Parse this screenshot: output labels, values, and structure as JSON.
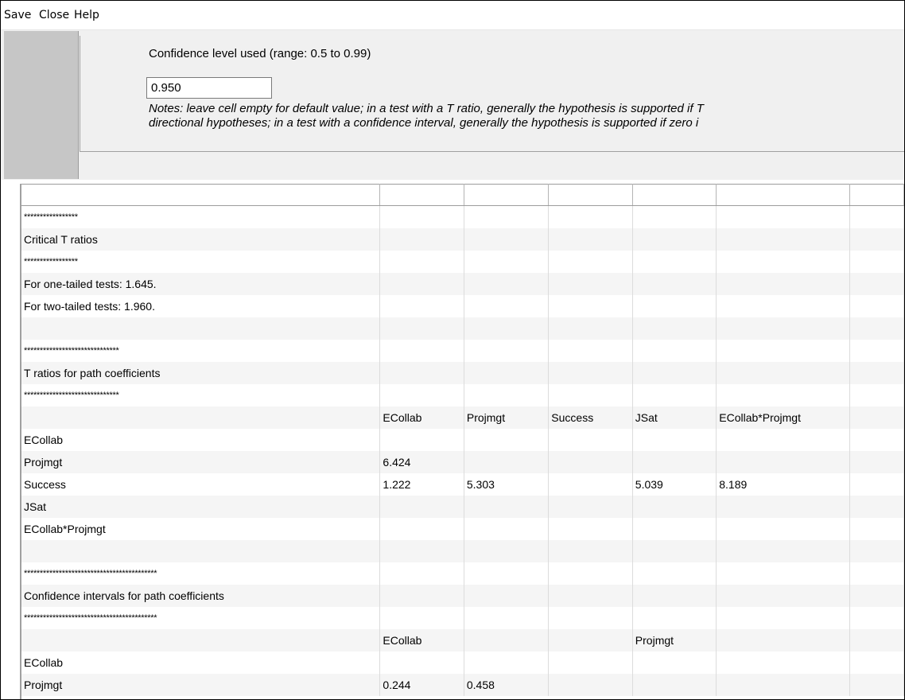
{
  "menu": [
    "Save",
    "Close",
    "Help"
  ],
  "settings": {
    "confidence_label": "Confidence level used (range: 0.5 to 0.99)",
    "confidence_value": "0.950",
    "notes_line1": "Notes: leave cell empty for default value; in a test with a T ratio, generally the hypothesis is supported if T",
    "notes_line2": "directional hypotheses; in a test with a confidence interval, generally the hypothesis is supported if zero i"
  },
  "grid": {
    "columns": [
      "",
      "",
      "",
      "",
      "",
      "",
      ""
    ],
    "rows": [
      [
        "*****************",
        "",
        "",
        "",
        "",
        "",
        ""
      ],
      [
        "Critical T ratios",
        "",
        "",
        "",
        "",
        "",
        ""
      ],
      [
        "*****************",
        "",
        "",
        "",
        "",
        "",
        ""
      ],
      [
        "For one-tailed tests: 1.645.",
        "",
        "",
        "",
        "",
        "",
        ""
      ],
      [
        "For two-tailed tests: 1.960.",
        "",
        "",
        "",
        "",
        "",
        ""
      ],
      [
        "",
        "",
        "",
        "",
        "",
        "",
        ""
      ],
      [
        "******************************",
        "",
        "",
        "",
        "",
        "",
        ""
      ],
      [
        "T ratios for path coefficients",
        "",
        "",
        "",
        "",
        "",
        ""
      ],
      [
        "******************************",
        "",
        "",
        "",
        "",
        "",
        ""
      ],
      [
        "",
        "ECollab",
        "Projmgt",
        "Success",
        "JSat",
        "ECollab*Projmgt",
        ""
      ],
      [
        "ECollab",
        "",
        "",
        "",
        "",
        "",
        ""
      ],
      [
        "Projmgt",
        "6.424",
        "",
        "",
        "",
        "",
        ""
      ],
      [
        "Success",
        "1.222",
        "5.303",
        "",
        "5.039",
        "8.189",
        ""
      ],
      [
        "JSat",
        "",
        "",
        "",
        "",
        "",
        ""
      ],
      [
        "ECollab*Projmgt",
        "",
        "",
        "",
        "",
        "",
        ""
      ],
      [
        "",
        "",
        "",
        "",
        "",
        "",
        ""
      ],
      [
        "******************************************",
        "",
        "",
        "",
        "",
        "",
        ""
      ],
      [
        "Confidence intervals for path coefficients",
        "",
        "",
        "",
        "",
        "",
        ""
      ],
      [
        "******************************************",
        "",
        "",
        "",
        "",
        "",
        ""
      ],
      [
        "",
        "ECollab",
        "",
        "",
        "Projmgt",
        "",
        ""
      ],
      [
        "ECollab",
        "",
        "",
        "",
        "",
        "",
        ""
      ],
      [
        "Projmgt",
        "0.244",
        "0.458",
        "",
        "",
        "",
        ""
      ]
    ]
  }
}
